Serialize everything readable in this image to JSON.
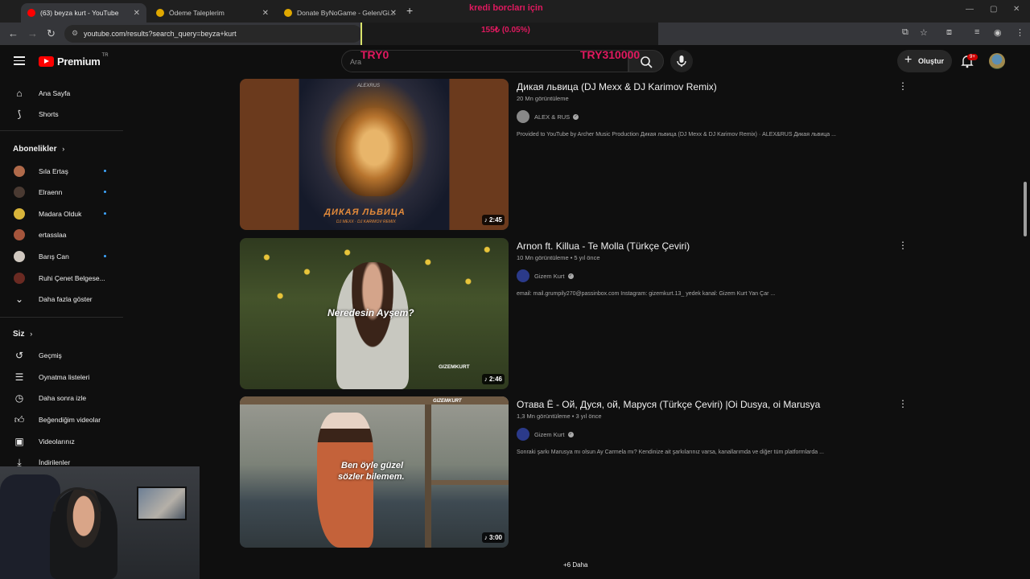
{
  "browser": {
    "tabs": [
      {
        "title": "(63) beyza kurt - YouTube",
        "active": true,
        "favicon_color": "#ff0000"
      },
      {
        "title": "Ödeme Taleplerim",
        "active": false,
        "favicon_color": "#e0a800"
      },
      {
        "title": "Donate ByNoGame - Gelen/Gi...",
        "active": false,
        "favicon_color": "#e0a800"
      }
    ],
    "url": "youtube.com/results?search_query=beyza+kurt"
  },
  "overlay": {
    "top_text": "kredi borcları için",
    "percent_text": "155₺ (0.05%)",
    "left_text": "TRY0",
    "right_text": "TRY310000",
    "color": "#e0195f"
  },
  "masthead": {
    "brand": "Premium",
    "region": "TR",
    "search_placeholder": "Ara",
    "create_label": "Oluştur",
    "notif_badge": "9+"
  },
  "sidebar": {
    "home": "Ana Sayfa",
    "shorts": "Shorts",
    "subs_header": "Abonelikler",
    "subscriptions": [
      {
        "name": "Sıla Ertaş",
        "live": true,
        "color": "#b06a4a"
      },
      {
        "name": "Elraenn",
        "live": true,
        "color": "#4a3a32"
      },
      {
        "name": "Madara Olduk",
        "live": true,
        "color": "#d8b43a"
      },
      {
        "name": "ertasslaa",
        "live": false,
        "color": "#a5553c"
      },
      {
        "name": "Barış Can",
        "live": true,
        "color": "#d0c8c0"
      },
      {
        "name": "Ruhi Çenet Belgese...",
        "live": false,
        "color": "#6a2a22"
      }
    ],
    "show_more": "Daha fazla göster",
    "you_header": "Siz",
    "you_items": [
      "Geçmiş",
      "Oynatma listeleri",
      "Daha sonra izle",
      "Beğendiğim videolar",
      "Videolarınız",
      "İndirilenler"
    ]
  },
  "results": [
    {
      "title": "Дикая львица (DJ Mexx & DJ Karimov Remix)",
      "meta": "20 Mn görüntüleme",
      "channel": "ALEX & RUS",
      "description": "Provided to YouTube by Archer Music Production Дикая львица (DJ Mexx & DJ Karimov Remix) · ALEX&RUS Дикая львица ...",
      "duration": "2:45",
      "thumb_text_top": "ALEXRUS",
      "thumb_text_main": "ДИКАЯ ЛЬВИЦА",
      "thumb_text_sub": "DJ MEXX · DJ KARIMOV REMIX"
    },
    {
      "title": "Arnon ft. Killua - Te Molla (Türkçe Çeviri)",
      "meta": "10 Mn görüntüleme • 5 yıl önce",
      "channel": "Gizem Kurt",
      "description": "email: mail.grumpily270@passinbox.com Instagram: gizemkurt.13_ yedek kanal: Gizem Kurt Yan Çar ...",
      "duration": "2:46",
      "thumb_subtitle": "Neredesin Ayşem?",
      "thumb_watermark": "GIZEMKURT"
    },
    {
      "title": "Отава Ё - Ой, Дуся, ой, Маруся (Türkçe Çeviri) |Oi Dusya, oi Marusya",
      "meta": "1,3 Mn görüntüleme • 3 yıl önce",
      "channel": "Gizem Kurt",
      "description": "Sonraki şarkı Marusya mı olsun Ay Carmela mı? Kendinize ait şarkılarınız varsa, kanallarımda ve diğer tüm platformlarda ...",
      "duration": "3:00",
      "thumb_subtitle_1": "Ben öyle güzel",
      "thumb_subtitle_2": "sözler bilemem.",
      "thumb_watermark": "GIZEMKURT"
    }
  ],
  "more_label": "+6 Daha"
}
